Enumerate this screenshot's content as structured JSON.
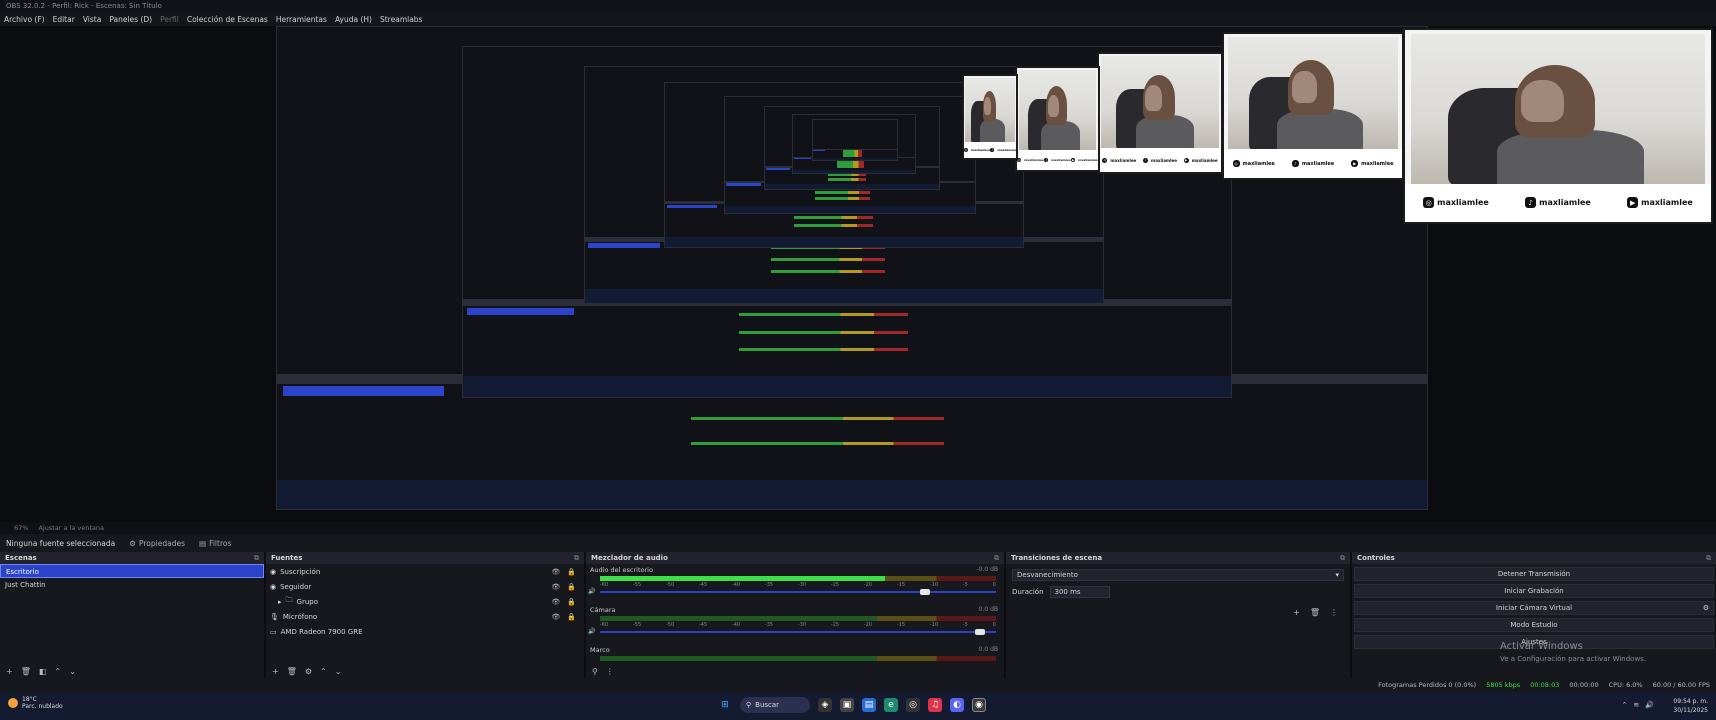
{
  "window": {
    "title": "OBS 32.0.2 - Perfil: Rick - Escenas: Sin Título"
  },
  "menu": [
    "Archivo (F)",
    "Editar",
    "Vista",
    "Paneles (D)",
    "Perfil",
    "Colección de Escenas",
    "Herramientas",
    "Ayuda (H)",
    "Streamlabs"
  ],
  "zoom": {
    "value": "67%",
    "fit": "Ajustar a la ventana"
  },
  "props": {
    "no_source": "Ninguna fuente seleccionada",
    "properties": "Propiedades",
    "filters": "Filtros"
  },
  "webcam": {
    "instagram": "maxliamlee",
    "tiktok": "maxliamlee",
    "youtube": "maxliamlee"
  },
  "scenes": {
    "title": "Escenas",
    "items": [
      "Escritorio",
      "Just Chattin"
    ],
    "selected": 0
  },
  "sources": {
    "title": "Fuentes",
    "items": [
      "Suscripción",
      "Seguidor",
      "Grupo",
      "Micrófono",
      "AMD Radeon 7900 GRE"
    ]
  },
  "mixer": {
    "title": "Mezclador de audio",
    "channels": [
      {
        "name": "Audio del escritorio",
        "db": "-0.0 dB",
        "level": 0.72,
        "volume": 0.82
      },
      {
        "name": "Cámara",
        "db": "0.0 dB",
        "level": 0.0,
        "volume": 0.96
      },
      {
        "name": "Marco",
        "db": "0.0 dB",
        "level": 0.0,
        "volume": 0.9
      }
    ],
    "scale": [
      "-60",
      "-55",
      "-50",
      "-45",
      "-40",
      "-35",
      "-30",
      "-25",
      "-20",
      "-15",
      "-10",
      "-5",
      "0"
    ]
  },
  "transitions": {
    "title": "Transiciones de escena",
    "type": "Desvanecimiento",
    "duration_label": "Duración",
    "duration": "300 ms"
  },
  "controls": {
    "title": "Controles",
    "buttons": [
      "Detener Transmisión",
      "Iniciar Grabación",
      "Iniciar Cámara Virtual",
      "Modo Estudio",
      "Ajustes"
    ]
  },
  "watermark": {
    "line1": "Activar Windows",
    "line2": "Ve a Configuración para activar Windows."
  },
  "status": {
    "dropped": "Fotogramas Perdidos 0 (0.0%)",
    "bitrate": "5805 kbps",
    "stream_time": "00:08:03",
    "rec_time": "00:00:00",
    "cpu": "CPU: 6.0%",
    "fps": "60.00 / 60.00 FPS"
  },
  "taskbar": {
    "temp": "18°C",
    "weather": "Parc. nublado",
    "search": "Buscar",
    "time": "09:54 p. m.",
    "date": "30/11/2025"
  },
  "colors": {
    "accent": "#2a44c9",
    "meter_green": "#3ce04a",
    "meter_yellow": "#b19a1e",
    "meter_red": "#a12828"
  }
}
